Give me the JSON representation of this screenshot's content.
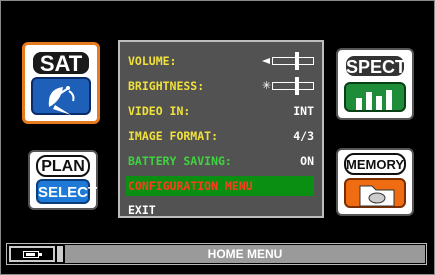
{
  "home_tiles": {
    "sat": {
      "label": "SAT"
    },
    "plan": {
      "label": "PLAN",
      "sub_label": "SELECT"
    },
    "spect": {
      "label": "SPECT"
    },
    "memory": {
      "label": "MEMORY"
    }
  },
  "config_menu": {
    "rows": [
      {
        "key": "VOLUME:",
        "control": "slider",
        "level": 0.6
      },
      {
        "key": "BRIGHTNESS:",
        "control": "slider",
        "level": 0.6
      },
      {
        "key": "VIDEO IN:",
        "value": "INT"
      },
      {
        "key": "IMAGE FORMAT:",
        "value": "4/3"
      },
      {
        "key": "BATTERY SAVING:",
        "value": "ON"
      },
      {
        "key": "CONFIGURATION MENU",
        "selected": true
      },
      {
        "key": "EXIT"
      }
    ]
  },
  "status_bar": {
    "title": "HOME MENU",
    "battery_icon": "battery-icon"
  },
  "colors": {
    "menu_key": "#f0e03c",
    "battery_saving": "#3fd43f",
    "selected_text": "#ff3b1e",
    "selected_bg": "#0b8f12",
    "sat_border": "#e57a1f"
  }
}
